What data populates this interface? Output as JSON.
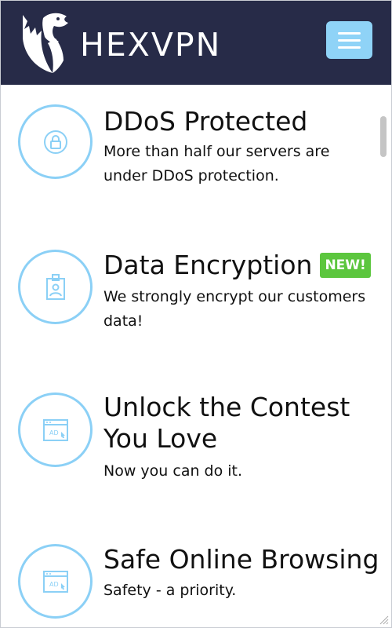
{
  "brand": {
    "name": "HEXVPN",
    "logo_icon": "wolf-shield-logo"
  },
  "header": {
    "menu_icon": "hamburger-menu-icon"
  },
  "colors": {
    "header_bg": "#272b48",
    "accent": "#8bd0f6",
    "menu_button": "#8fd3f7",
    "badge": "#5cc63e",
    "text": "#111111"
  },
  "features": [
    {
      "icon": "lock-icon",
      "title": "DDoS Protected",
      "description": "More than half our servers are under DDoS protection."
    },
    {
      "icon": "id-card-icon",
      "title": "Data Encryption",
      "badge": "NEW!",
      "description": "We strongly encrypt our customers data!"
    },
    {
      "icon": "ad-browser-icon",
      "title_line1": "Unlock the Contest",
      "title_line2": "You Love",
      "description": "Now you can do it."
    },
    {
      "icon": "ad-browser-icon",
      "title": "Safe Online Browsing",
      "description": "Safety - a priority."
    }
  ]
}
